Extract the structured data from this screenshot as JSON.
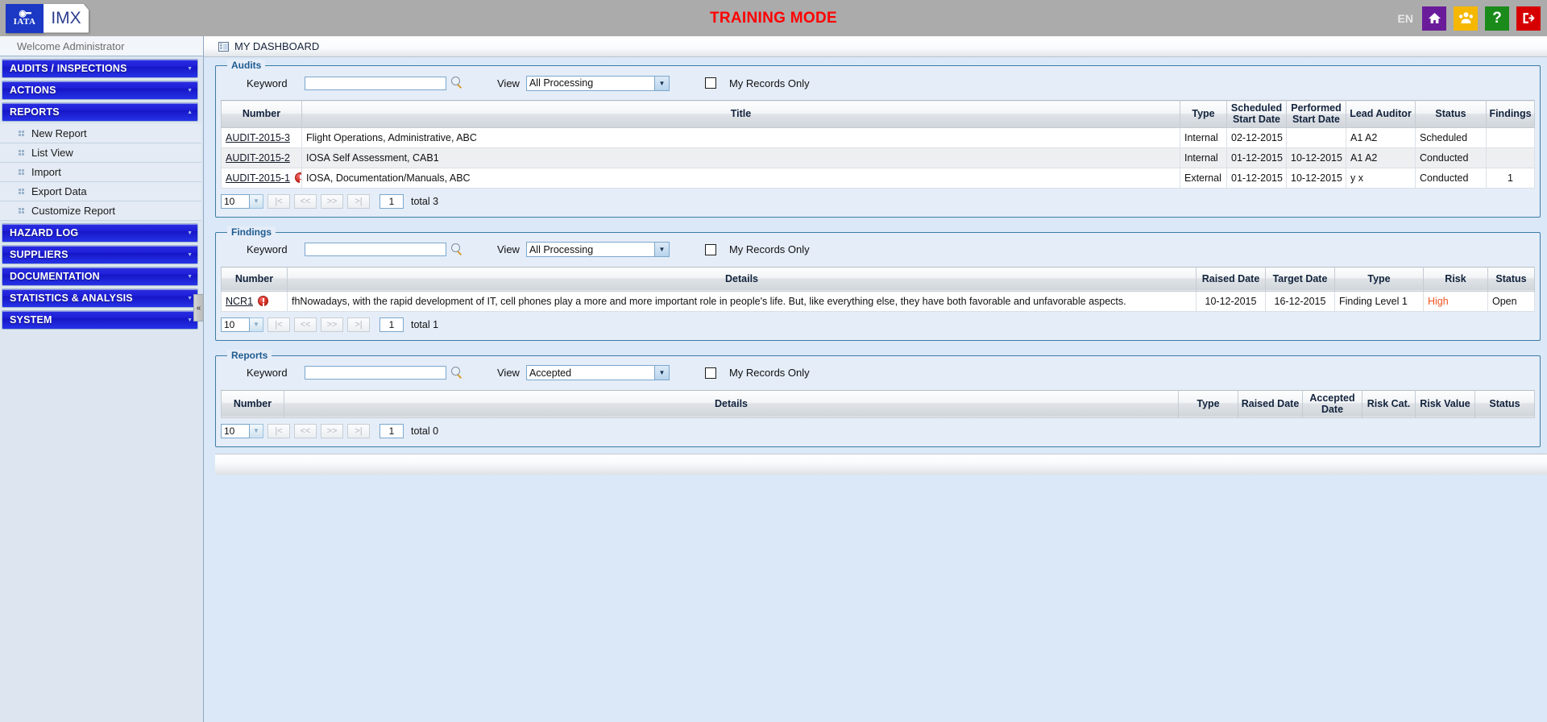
{
  "header": {
    "logo_tata": "IATA",
    "logo_imx": "IMX",
    "training_mode": "TRAINING MODE",
    "language": "EN",
    "icons": [
      {
        "name": "home-icon",
        "glyph": "⌂",
        "color": "#6a1b9a"
      },
      {
        "name": "users-icon",
        "glyph": "♟",
        "color": "#f5b700"
      },
      {
        "name": "help-icon",
        "glyph": "?",
        "color": "#1a8a1a"
      },
      {
        "name": "logout-icon",
        "glyph": "↪",
        "color": "#d60000"
      }
    ]
  },
  "sidebar": {
    "welcome": "Welcome  Administrator",
    "collapse_glyph": "«",
    "groups": [
      {
        "label": "AUDITS / INSPECTIONS",
        "expanded": false,
        "chevron": "ˇ",
        "items": []
      },
      {
        "label": "ACTIONS",
        "expanded": false,
        "chevron": "ˇ",
        "items": []
      },
      {
        "label": "REPORTS",
        "expanded": true,
        "chevron": "ˆ",
        "items": [
          "New Report",
          "List View",
          "Import",
          "Export Data",
          "Customize Report"
        ]
      },
      {
        "label": "HAZARD LOG",
        "expanded": false,
        "chevron": "ˇ",
        "items": []
      },
      {
        "label": "SUPPLIERS",
        "expanded": false,
        "chevron": "ˇ",
        "items": []
      },
      {
        "label": "DOCUMENTATION",
        "expanded": false,
        "chevron": "ˇ",
        "items": []
      },
      {
        "label": "STATISTICS & ANALYSIS",
        "expanded": false,
        "chevron": "ˇ",
        "items": []
      },
      {
        "label": "SYSTEM",
        "expanded": false,
        "chevron": "ˇ",
        "items": []
      }
    ]
  },
  "breadcrumb": {
    "title": "MY DASHBOARD"
  },
  "common": {
    "keyword_label": "Keyword",
    "keyword_value": "",
    "keyword_placeholder": "",
    "view_label": "View",
    "my_records_label": "My Records Only",
    "select_arrow": "▼",
    "pager": {
      "page_size": "10",
      "page_number": "1",
      "first": "|<",
      "prev": "<<",
      "next": ">>",
      "last": ">|"
    }
  },
  "audits": {
    "legend": "Audits",
    "view_value": "All Processing",
    "my_records_checked": false,
    "columns": [
      "Number",
      "Title",
      "Type",
      "Scheduled Start Date",
      "Performed Start Date",
      "Lead Auditor",
      "Status",
      "Findings"
    ],
    "rows": [
      {
        "number": "AUDIT-2015-3",
        "warning": false,
        "title": "Flight Operations, Administrative, ABC",
        "type": "Internal",
        "scheduled_start": "02-12-2015",
        "performed_start": "",
        "lead_auditor": "A1 A2",
        "status": "Scheduled",
        "findings": ""
      },
      {
        "number": "AUDIT-2015-2",
        "warning": false,
        "title": "IOSA Self Assessment, CAB1",
        "type": "Internal",
        "scheduled_start": "01-12-2015",
        "performed_start": "10-12-2015",
        "lead_auditor": "A1 A2",
        "status": "Conducted",
        "findings": ""
      },
      {
        "number": "AUDIT-2015-1",
        "warning": true,
        "title": "IOSA, Documentation/Manuals, ABC",
        "type": "External",
        "scheduled_start": "01-12-2015",
        "performed_start": "10-12-2015",
        "lead_auditor": "y x",
        "status": "Conducted",
        "findings": "1"
      }
    ],
    "total_text": "total 3"
  },
  "findings": {
    "legend": "Findings",
    "view_value": "All Processing",
    "my_records_checked": false,
    "columns": [
      "Number",
      "Details",
      "Raised Date",
      "Target Date",
      "Type",
      "Risk",
      "Status"
    ],
    "rows": [
      {
        "number": "NCR1",
        "warning": true,
        "details": "fhNowadays, with the rapid development of IT, cell phones play a more and more important role in people's life. But, like everything else, they have both favorable and unfavorable aspects.",
        "raised_date": "10-12-2015",
        "target_date": "16-12-2015",
        "type": "Finding Level 1",
        "risk": "High",
        "risk_color": "#f4531f",
        "status": "Open"
      }
    ],
    "total_text": "total 1"
  },
  "reports": {
    "legend": "Reports",
    "view_value": "Accepted",
    "my_records_checked": false,
    "columns": [
      "Number",
      "Details",
      "Type",
      "Raised Date",
      "Accepted Date",
      "Risk Cat.",
      "Risk Value",
      "Status"
    ],
    "rows": [],
    "total_text": "total 0"
  }
}
